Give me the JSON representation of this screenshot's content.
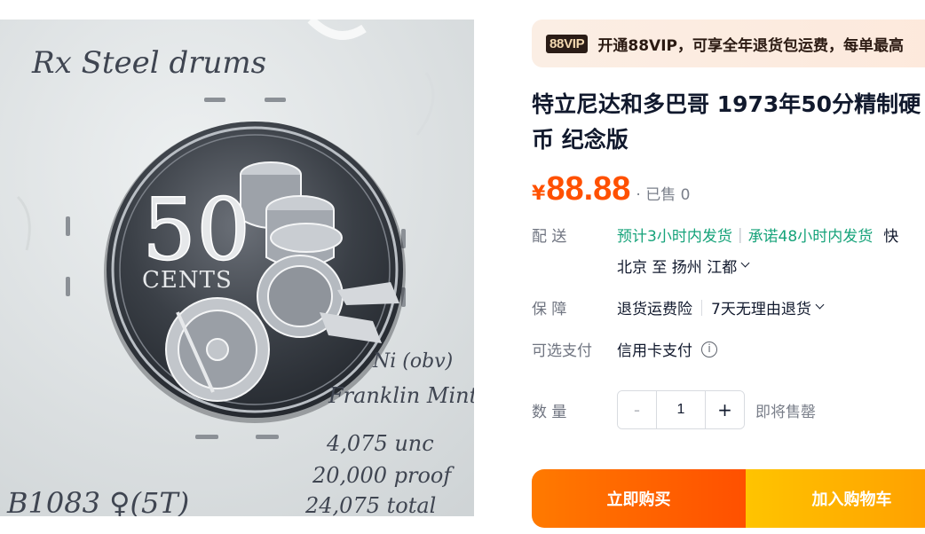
{
  "image": {
    "alt": "coin-photo",
    "handwriting": {
      "top": "Rx Steel drums",
      "note1": "Ni (obv)",
      "note2": "Franklin Mint",
      "note3": "4,075 unc",
      "note4": "20,000 proof",
      "note5": "24,075 total",
      "code": "B1083 ♀(5T)"
    },
    "coin": {
      "denomination": "50",
      "unit": "CENTS"
    }
  },
  "vip": {
    "badge": "88VIP",
    "text": "开通88VIP，可享全年退货包运费，每单最高"
  },
  "product": {
    "title": "特立尼达和多巴哥 1973年50分精制硬币 纪念版",
    "price_symbol": "¥",
    "price": "88.88",
    "sold": "· 已售 0"
  },
  "delivery": {
    "label": "配 送",
    "promise1": "预计3小时内发货",
    "divider": "|",
    "promise2": "承诺48小时内发货",
    "extra": "快",
    "route": "北京  至  扬州 江都"
  },
  "guarantee": {
    "label": "保 障",
    "item1": "退货运费险",
    "item2": "7天无理由退货"
  },
  "payment": {
    "label": "可选支付",
    "method": "信用卡支付",
    "info": "i"
  },
  "quantity": {
    "label": "数 量",
    "minus": "-",
    "value": "1",
    "plus": "+",
    "stock_status": "即将售罄"
  },
  "actions": {
    "buy": "立即购买",
    "cart": "加入购物车"
  },
  "colors": {
    "price": "#ff5000",
    "promise": "#16a37a",
    "buy_button": "#ff5000",
    "cart_button": "#ffb000"
  }
}
